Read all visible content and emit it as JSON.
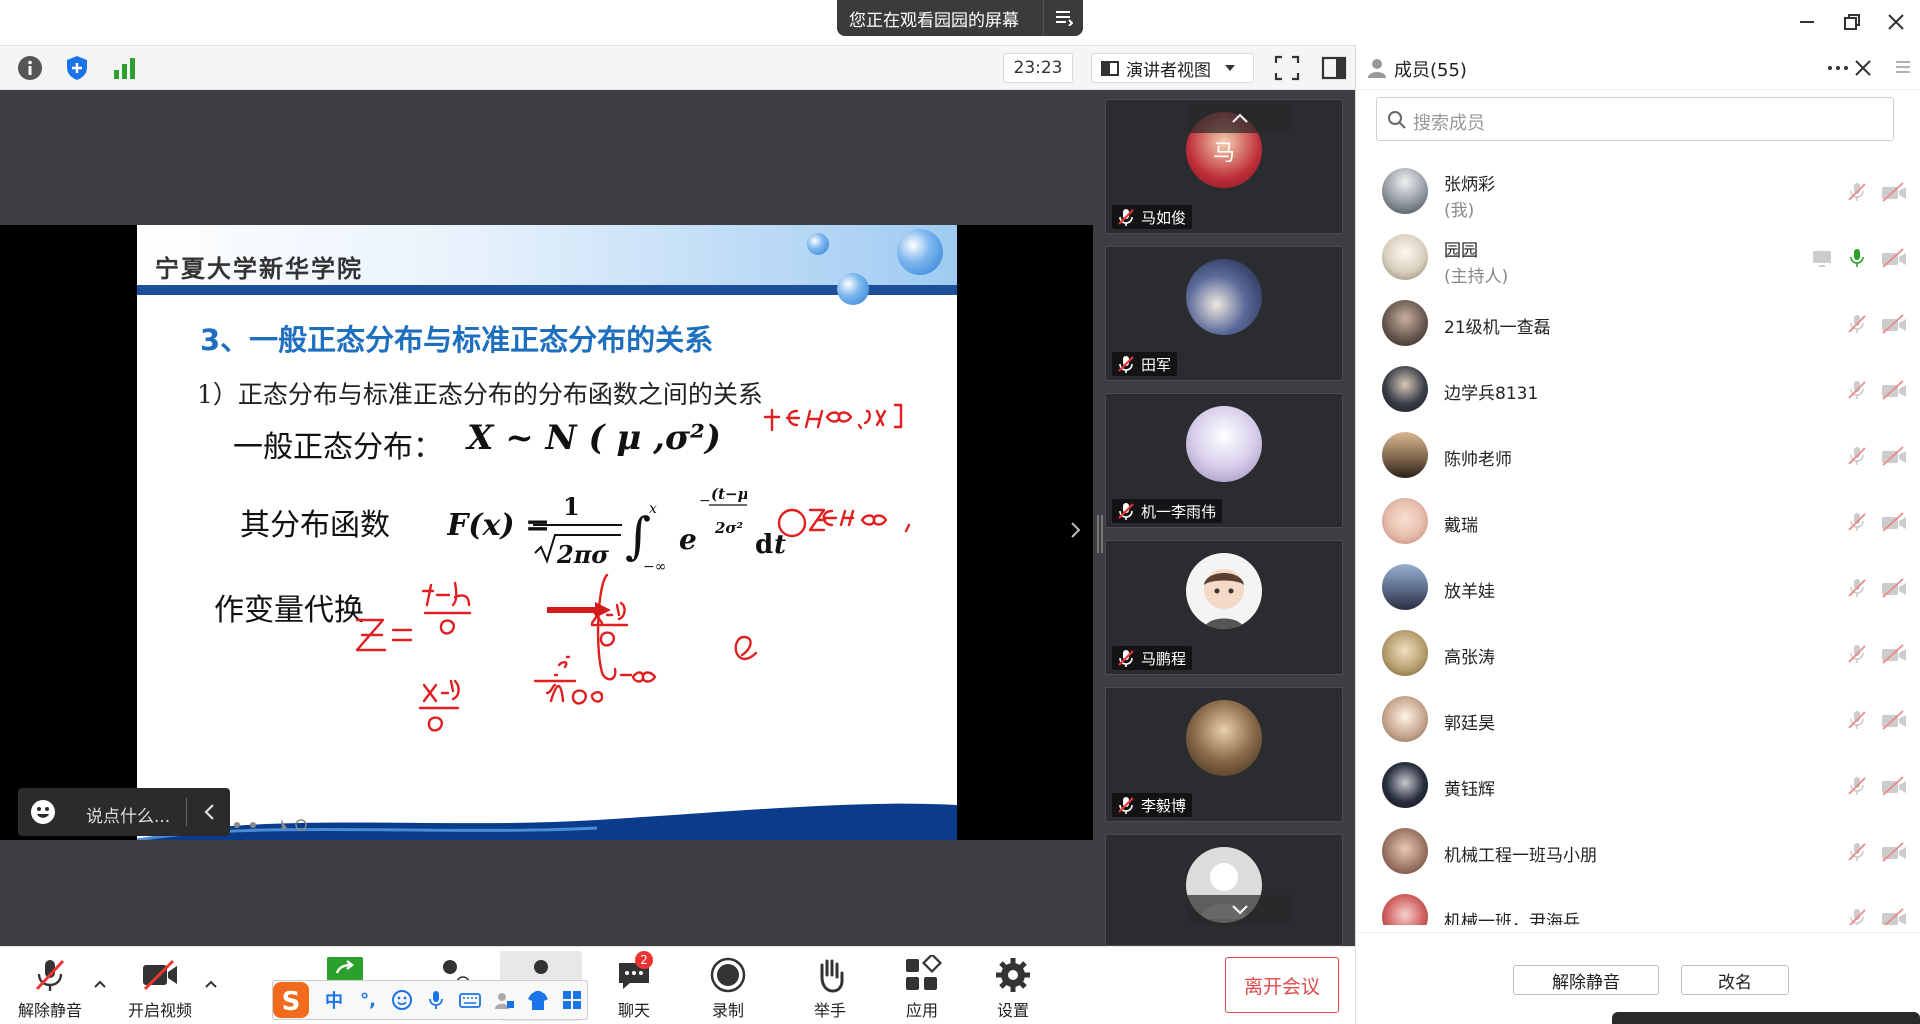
{
  "banner": {
    "text": "您正在观看园园的屏幕"
  },
  "toolbar": {
    "timer": "23:23",
    "view_label": "演讲者视图"
  },
  "slide": {
    "school": "宁夏大学新华学院",
    "section_title": "3、一般正态分布与标准正态分布的关系",
    "sub_title": "1）正态分布与标准正态分布的分布函数之间的关系",
    "eq1_label": "一般正态分布：",
    "eq1": "X ~ N ( μ ,σ²)",
    "eq2_label": "其分布函数",
    "eq3_label": "作变量代换"
  },
  "chat_popup": {
    "placeholder": "说点什么..."
  },
  "video_tiles": [
    {
      "name": "马如俊",
      "avatar_color": "#c0303a"
    },
    {
      "name": "田军",
      "avatar_color": "#3a4a7a"
    },
    {
      "name": "机一李雨伟",
      "avatar_color": "#b8b8d8"
    },
    {
      "name": "马鹏程",
      "avatar_color": "#f2f2f2"
    },
    {
      "name": "李毅博",
      "avatar_color": "#8a6a4a"
    }
  ],
  "bottom": {
    "unmute": "解除静音",
    "video": "开启视频",
    "chat": "聊天",
    "chat_badge": "2",
    "record": "录制",
    "raise": "举手",
    "apps": "应用",
    "settings": "设置",
    "leave": "离开会议"
  },
  "ime": {
    "mode": "中",
    "punct": "°,"
  },
  "sidebar": {
    "title": "成员(55)",
    "search_placeholder": "搜索成员",
    "members": [
      {
        "name": "张炳彩",
        "role": "(我)",
        "color": "#9aa0a8"
      },
      {
        "name": "园园",
        "role": "(主持人)",
        "color": "#d8cfc0",
        "host": true
      },
      {
        "name": "21级机一查磊",
        "role": "",
        "color": "#6a5a50"
      },
      {
        "name": "边学兵8131",
        "role": "",
        "color": "#3a3f48"
      },
      {
        "name": "陈帅老师",
        "role": "",
        "color": "#7a6048"
      },
      {
        "name": "戴瑞",
        "role": "",
        "color": "#e8c0b0"
      },
      {
        "name": "放羊娃",
        "role": "",
        "color": "#5a6a88"
      },
      {
        "name": "高张涛",
        "role": "",
        "color": "#b8a070"
      },
      {
        "name": "郭廷昊",
        "role": "",
        "color": "#c8a890"
      },
      {
        "name": "黄钰辉",
        "role": "",
        "color": "#2a3040"
      },
      {
        "name": "机械工程一班马小朋",
        "role": "",
        "color": "#a07868"
      },
      {
        "name": "机械一班，尹海兵",
        "role": "",
        "color": "#d06060"
      }
    ],
    "unmute_all": "解除静音",
    "rename": "改名"
  }
}
